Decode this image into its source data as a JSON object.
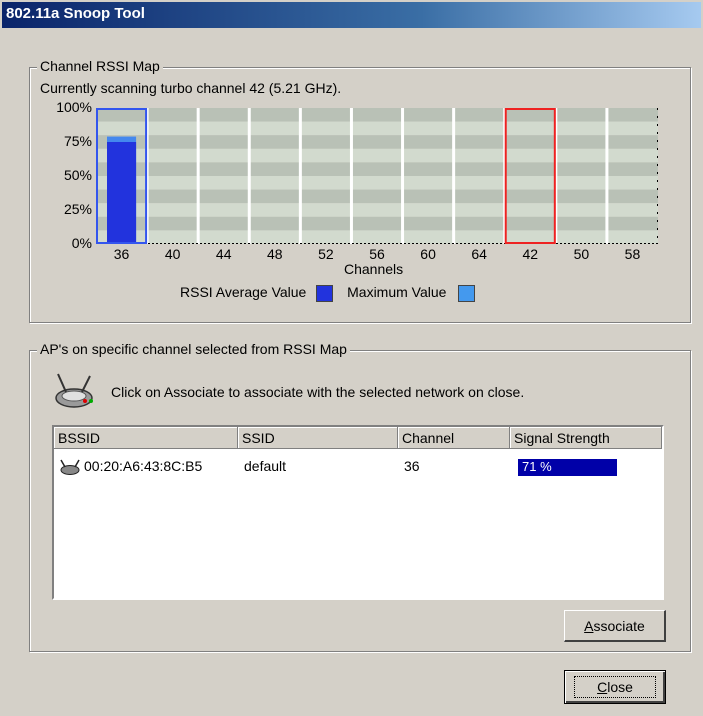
{
  "window": {
    "title": "802.11a Snoop Tool"
  },
  "rssi_group": {
    "title": "Channel RSSI Map",
    "status_text": "Currently scanning turbo channel 42 (5.21 GHz).",
    "legend_avg_label": "RSSI Average Value",
    "legend_max_label": "Maximum Value"
  },
  "chart_data": {
    "type": "bar",
    "categories": [
      "36",
      "40",
      "44",
      "48",
      "52",
      "56",
      "60",
      "64",
      "42",
      "50",
      "58"
    ],
    "series": [
      {
        "name": "RSSI Average Value",
        "values": [
          75,
          0,
          0,
          0,
          0,
          0,
          0,
          0,
          0,
          0,
          0
        ]
      },
      {
        "name": "Maximum Value",
        "values": [
          79,
          0,
          0,
          0,
          0,
          0,
          0,
          0,
          0,
          0,
          0
        ]
      }
    ],
    "xlabel": "Channels",
    "ylabel": "",
    "ylim": [
      0,
      100
    ],
    "yticks": [
      "0%",
      "25%",
      "50%",
      "75%",
      "100%"
    ],
    "selected_category": "36",
    "scanning_category": "42",
    "colors": {
      "avg": "#2233dd",
      "max": "#4488ee",
      "selected_outline": "#3355ee",
      "scanning_outline": "#ee2222",
      "band_dark": "#b9c1b6",
      "band_light": "#d2dace"
    },
    "grid": true
  },
  "ap_group": {
    "title": "AP's on specific channel selected from RSSI Map",
    "icon": "satellite-dish-icon",
    "instruction": "Click on Associate to associate with the selected network on close.",
    "columns": [
      "BSSID",
      "SSID",
      "Channel",
      "Signal Strength"
    ],
    "rows": [
      {
        "icon": "access-point-icon",
        "bssid": "00:20:A6:43:8C:B5",
        "ssid": "default",
        "channel": "36",
        "signal_text": "71 %",
        "signal_pct": 71
      }
    ],
    "associate_button": {
      "underlined": "A",
      "rest": "ssociate"
    }
  },
  "close_button": {
    "underlined": "C",
    "rest": "lose"
  }
}
